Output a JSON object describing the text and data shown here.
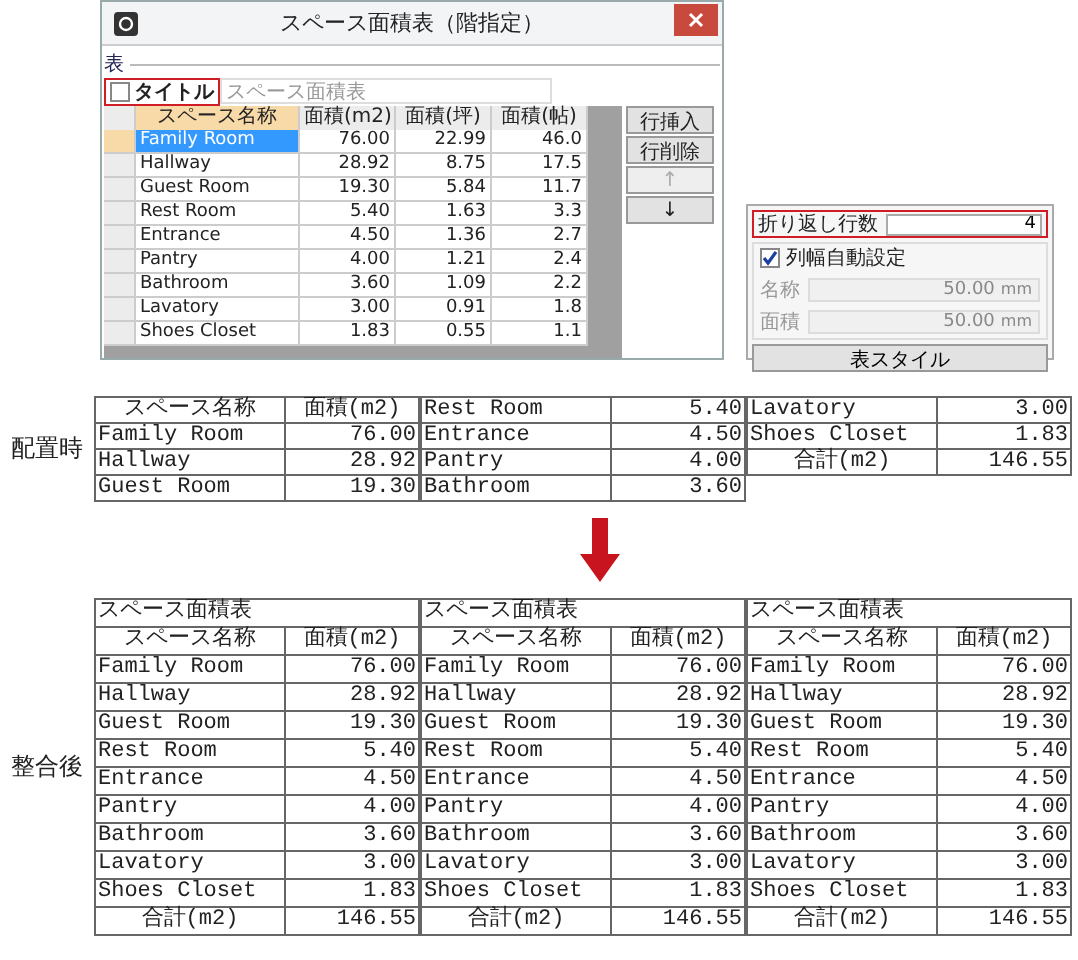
{
  "dialog": {
    "title": "スペース面積表（階指定）",
    "section_label": "表",
    "title_option": {
      "label": "タイトル",
      "checked": false,
      "value": "スペース面積表",
      "disabled": true
    },
    "grid": {
      "columns": [
        {
          "label": "スペース名称",
          "selected": true
        },
        {
          "label": "面積(m2)",
          "selected": false
        },
        {
          "label": "面積(坪)",
          "selected": false
        },
        {
          "label": "面積(帖)",
          "selected": false
        }
      ],
      "rows": [
        {
          "cells": [
            "Family Room",
            "76.00",
            "22.99",
            "46.0"
          ],
          "selected": true
        },
        {
          "cells": [
            "Hallway",
            "28.92",
            "8.75",
            "17.5"
          ],
          "selected": false
        },
        {
          "cells": [
            "Guest Room",
            "19.30",
            "5.84",
            "11.7"
          ],
          "selected": false
        },
        {
          "cells": [
            "Rest Room",
            "5.40",
            "1.63",
            "3.3"
          ],
          "selected": false
        },
        {
          "cells": [
            "Entrance",
            "4.50",
            "1.36",
            "2.7"
          ],
          "selected": false
        },
        {
          "cells": [
            "Pantry",
            "4.00",
            "1.21",
            "2.4"
          ],
          "selected": false
        },
        {
          "cells": [
            "Bathroom",
            "3.60",
            "1.09",
            "2.2"
          ],
          "selected": false
        },
        {
          "cells": [
            "Lavatory",
            "3.00",
            "0.91",
            "1.8"
          ],
          "selected": false
        },
        {
          "cells": [
            "Shoes Closet",
            "1.83",
            "0.55",
            "1.1"
          ],
          "selected": false
        }
      ]
    },
    "buttons": [
      {
        "label": "行挿入",
        "disabled": false
      },
      {
        "label": "行削除",
        "disabled": false
      },
      {
        "label": "↑",
        "disabled": true
      },
      {
        "label": "↓",
        "disabled": false
      }
    ]
  },
  "options_panel": {
    "wrap_rows": {
      "label": "折り返し行数",
      "value": "4"
    },
    "auto_width": {
      "label": "列幅自動設定",
      "checked": true
    },
    "fields": [
      {
        "label": "名称",
        "value": "50.00",
        "unit": "mm",
        "disabled": true
      },
      {
        "label": "面積",
        "value": "50.00",
        "unit": "mm",
        "disabled": true
      }
    ],
    "style_button": "表スタイル"
  },
  "before": {
    "label": "配置時",
    "tables": [
      {
        "header": [
          "スペース名称",
          "面積(m2)"
        ],
        "rows": [
          [
            "Family Room",
            "76.00"
          ],
          [
            "Hallway",
            "28.92"
          ],
          [
            "Guest Room",
            "19.30"
          ]
        ]
      },
      {
        "rows": [
          [
            "Rest Room",
            "5.40"
          ],
          [
            "Entrance",
            "4.50"
          ],
          [
            "Pantry",
            "4.00"
          ],
          [
            "Bathroom",
            "3.60"
          ]
        ]
      },
      {
        "rows": [
          [
            "Lavatory",
            "3.00"
          ],
          [
            "Shoes Closet",
            "1.83"
          ]
        ],
        "total": [
          "合計(m2)",
          "146.55"
        ]
      }
    ]
  },
  "after": {
    "label": "整合後",
    "tables": [
      {
        "title": "スペース面積表",
        "header": [
          "スペース名称",
          "面積(m2)"
        ],
        "rows": [
          [
            "Family Room",
            "76.00"
          ],
          [
            "Hallway",
            "28.92"
          ],
          [
            "Guest Room",
            "19.30"
          ],
          [
            "Rest Room",
            "5.40"
          ],
          [
            "Entrance",
            "4.50"
          ],
          [
            "Pantry",
            "4.00"
          ],
          [
            "Bathroom",
            "3.60"
          ],
          [
            "Lavatory",
            "3.00"
          ],
          [
            "Shoes Closet",
            "1.83"
          ]
        ],
        "total": [
          "合計(m2)",
          "146.55"
        ]
      },
      {
        "title": "スペース面積表",
        "header": [
          "スペース名称",
          "面積(m2)"
        ],
        "rows": [
          [
            "Family Room",
            "76.00"
          ],
          [
            "Hallway",
            "28.92"
          ],
          [
            "Guest Room",
            "19.30"
          ],
          [
            "Rest Room",
            "5.40"
          ],
          [
            "Entrance",
            "4.50"
          ],
          [
            "Pantry",
            "4.00"
          ],
          [
            "Bathroom",
            "3.60"
          ],
          [
            "Lavatory",
            "3.00"
          ],
          [
            "Shoes Closet",
            "1.83"
          ]
        ],
        "total": [
          "合計(m2)",
          "146.55"
        ]
      },
      {
        "title": "スペース面積表",
        "header": [
          "スペース名称",
          "面積(m2)"
        ],
        "rows": [
          [
            "Family Room",
            "76.00"
          ],
          [
            "Hallway",
            "28.92"
          ],
          [
            "Guest Room",
            "19.30"
          ],
          [
            "Rest Room",
            "5.40"
          ],
          [
            "Entrance",
            "4.50"
          ],
          [
            "Pantry",
            "4.00"
          ],
          [
            "Bathroom",
            "3.60"
          ],
          [
            "Lavatory",
            "3.00"
          ],
          [
            "Shoes Closet",
            "1.83"
          ]
        ],
        "total": [
          "合計(m2)",
          "146.55"
        ]
      }
    ]
  }
}
